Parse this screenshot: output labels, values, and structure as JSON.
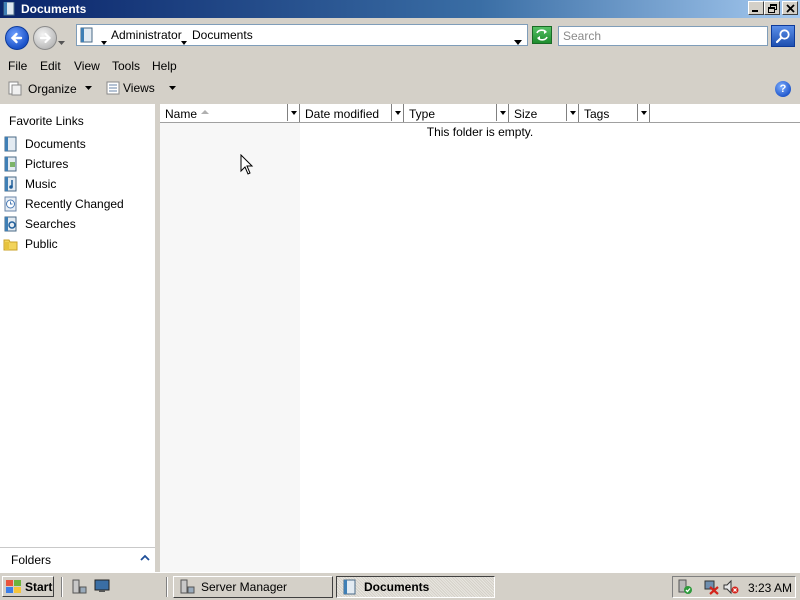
{
  "window": {
    "title": "Documents"
  },
  "address": {
    "crumbs": [
      "Administrator",
      "Documents"
    ],
    "search_placeholder": "Search"
  },
  "menu": [
    "File",
    "Edit",
    "View",
    "Tools",
    "Help"
  ],
  "commands": {
    "organize": "Organize",
    "views": "Views"
  },
  "nav": {
    "favorites_title": "Favorite Links",
    "items": [
      {
        "label": "Documents",
        "icon": "documents-icon"
      },
      {
        "label": "Pictures",
        "icon": "pictures-icon"
      },
      {
        "label": "Music",
        "icon": "music-icon"
      },
      {
        "label": "Recently Changed",
        "icon": "recently-changed-icon"
      },
      {
        "label": "Searches",
        "icon": "searches-icon"
      },
      {
        "label": "Public",
        "icon": "public-folder-icon"
      }
    ],
    "folders_label": "Folders"
  },
  "columns": [
    "Name",
    "Date modified",
    "Type",
    "Size",
    "Tags"
  ],
  "content": {
    "empty_message": "This folder is empty."
  },
  "taskbar": {
    "start_label": "Start",
    "tasks": [
      {
        "label": "Server Manager",
        "active": false
      },
      {
        "label": "Documents",
        "active": true
      }
    ],
    "clock": "3:23 AM"
  }
}
